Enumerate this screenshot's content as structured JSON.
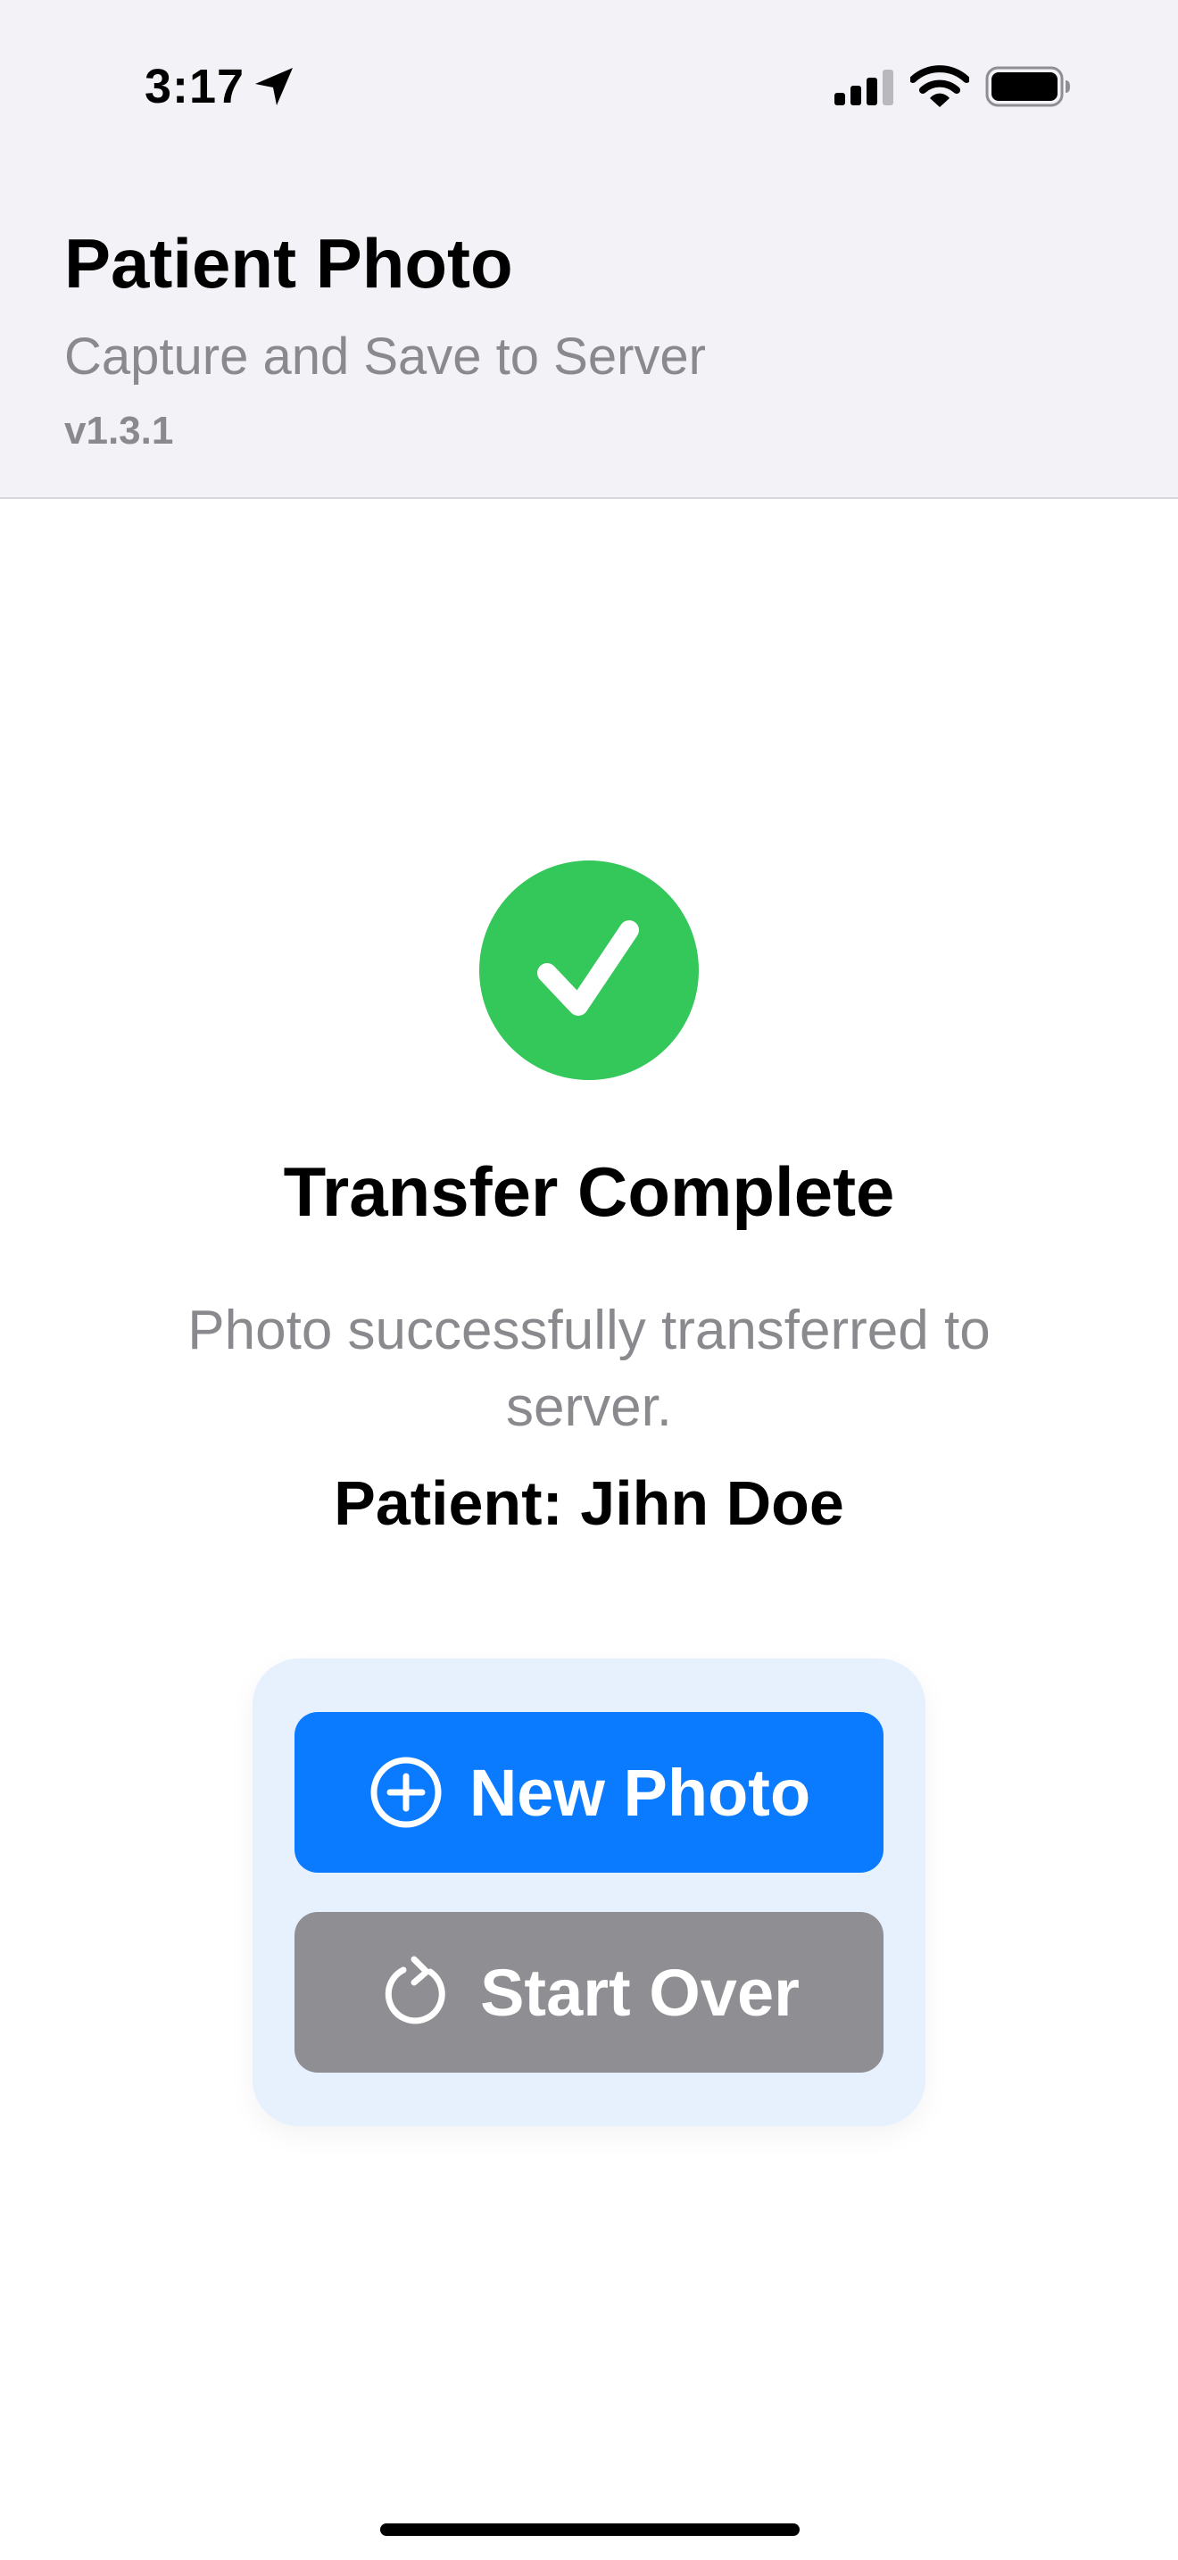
{
  "status_bar": {
    "time": "3:17",
    "icons": [
      "location-arrow-icon",
      "cellular-signal-icon",
      "wifi-icon",
      "battery-icon"
    ]
  },
  "header": {
    "title": "Patient Photo",
    "subtitle": "Capture and Save to Server",
    "version": "v1.3.1"
  },
  "result": {
    "icon": "checkmark-circle-icon",
    "title": "Transfer Complete",
    "message": "Photo successfully transferred to server.",
    "patient_line": "Patient: Jihn Doe"
  },
  "actions": {
    "new_photo_label": "New Photo",
    "new_photo_icon": "plus-circle-icon",
    "start_over_label": "Start Over",
    "start_over_icon": "refresh-icon"
  },
  "colors": {
    "header_bg": "#f2f2f7",
    "success": "#34c759",
    "primary": "#0a7aff",
    "secondary": "#8e8e93",
    "card_bg": "#e7f1fd",
    "muted_text": "#8a8a8e"
  }
}
